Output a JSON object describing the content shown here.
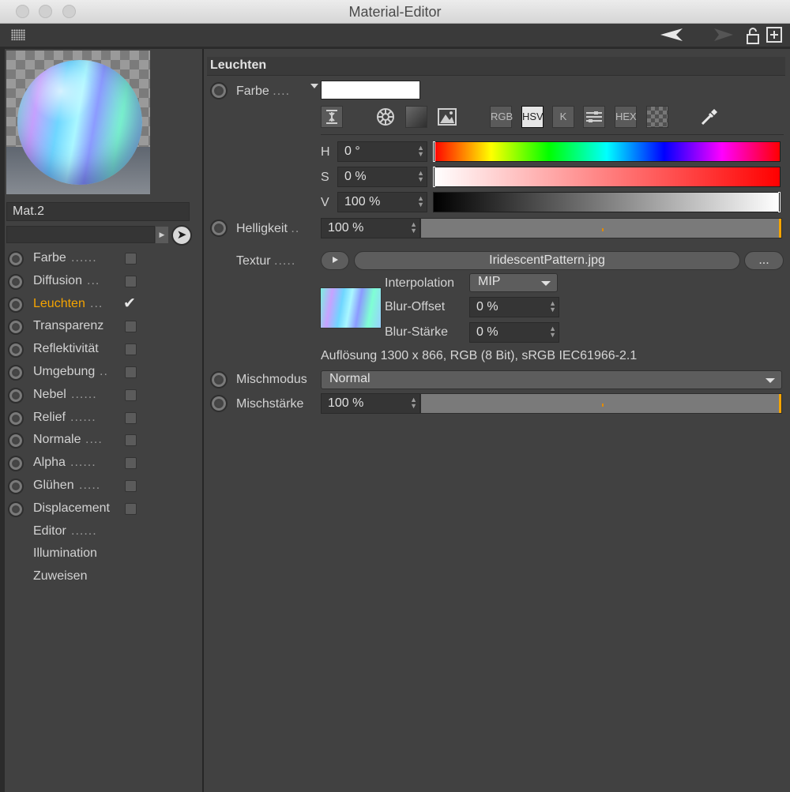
{
  "window": {
    "title": "Material-Editor"
  },
  "material": {
    "name": "Mat.2"
  },
  "channels": [
    {
      "label": "Farbe",
      "dots": "......",
      "checked": false,
      "active": false,
      "radio": true
    },
    {
      "label": "Diffusion",
      "dots": "...",
      "checked": false,
      "active": false,
      "radio": true
    },
    {
      "label": "Leuchten",
      "dots": "...",
      "checked": true,
      "active": true,
      "radio": true
    },
    {
      "label": "Transparenz",
      "dots": "",
      "checked": false,
      "active": false,
      "radio": true
    },
    {
      "label": "Reflektivität",
      "dots": "",
      "checked": false,
      "active": false,
      "radio": true
    },
    {
      "label": "Umgebung",
      "dots": "..",
      "checked": false,
      "active": false,
      "radio": true
    },
    {
      "label": "Nebel",
      "dots": "......",
      "checked": false,
      "active": false,
      "radio": true
    },
    {
      "label": "Relief",
      "dots": "......",
      "checked": false,
      "active": false,
      "radio": true
    },
    {
      "label": "Normale",
      "dots": "....",
      "checked": false,
      "active": false,
      "radio": true
    },
    {
      "label": "Alpha",
      "dots": "......",
      "checked": false,
      "active": false,
      "radio": true
    },
    {
      "label": "Glühen",
      "dots": ".....",
      "checked": false,
      "active": false,
      "radio": true
    },
    {
      "label": "Displacement",
      "dots": "",
      "checked": false,
      "active": false,
      "radio": true
    },
    {
      "label": "Editor",
      "dots": "......",
      "checked": false,
      "active": false,
      "radio": false
    },
    {
      "label": "Illumination",
      "dots": "",
      "checked": false,
      "active": false,
      "radio": false
    },
    {
      "label": "Zuweisen",
      "dots": "",
      "checked": false,
      "active": false,
      "radio": false
    }
  ],
  "section": {
    "title": "Leuchten"
  },
  "farbe": {
    "label": "Farbe",
    "dots": "....",
    "color": "#ffffff"
  },
  "color_modes": {
    "rgb": "RGB",
    "hsv": "HSV",
    "k": "K",
    "hex": "HEX"
  },
  "hsv": {
    "h": {
      "label": "H",
      "value": "0 °"
    },
    "s": {
      "label": "S",
      "value": "0 %"
    },
    "v": {
      "label": "V",
      "value": "100 %"
    }
  },
  "helligkeit": {
    "label": "Helligkeit",
    "dots": "..",
    "value": "100 %"
  },
  "textur": {
    "label": "Textur",
    "dots": ".....",
    "file": "IridescentPattern.jpg",
    "more": "...",
    "interpolation_label": "Interpolation",
    "interpolation_value": "MIP",
    "blur_offset_label": "Blur-Offset",
    "blur_offset_value": "0 %",
    "blur_staerke_label": "Blur-Stärke",
    "blur_staerke_value": "0 %",
    "info": "Auflösung 1300 x 866, RGB (8 Bit), sRGB IEC61966-2.1"
  },
  "mischmodus": {
    "label": "Mischmodus",
    "value": "Normal"
  },
  "mischstaerke": {
    "label": "Mischstärke",
    "value": "100 %"
  }
}
